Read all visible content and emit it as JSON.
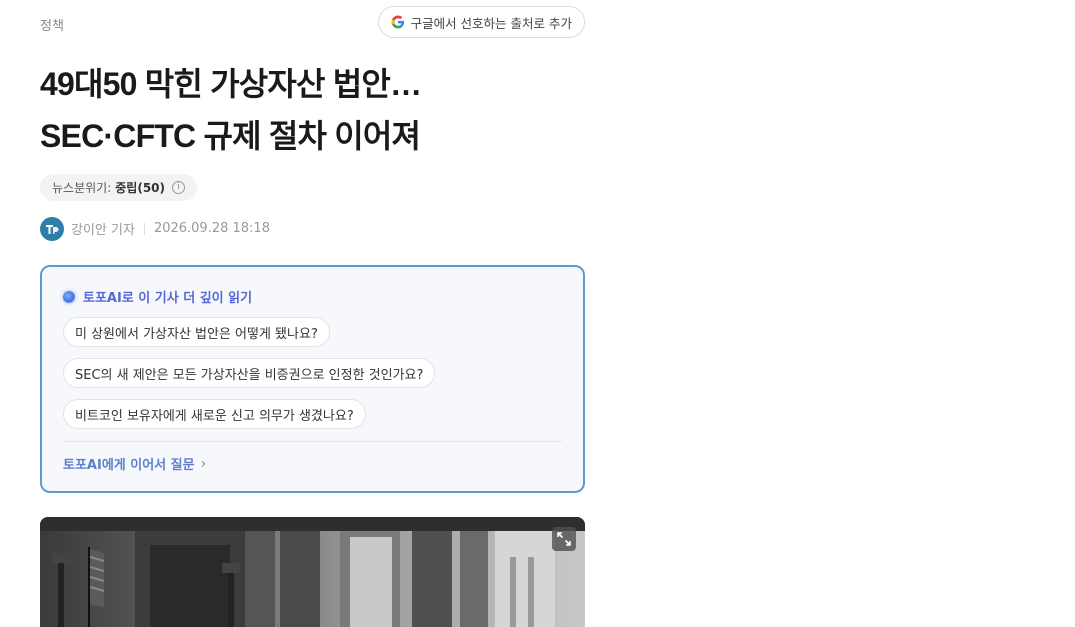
{
  "header": {
    "section": "정책",
    "google_button": "구글에서 선호하는 출처로 추가"
  },
  "article": {
    "title_line1": "49대50 막힌 가상자산 법안…",
    "title_line2": "SEC·CFTC 규제 절차 이어져",
    "sentiment_label": "뉴스분위기:",
    "sentiment_value": "중립(50)",
    "author": "강이안 기자",
    "datetime": "2026.09.28 18:18"
  },
  "ai_panel": {
    "heading": "토포AI로 이 기사 더 깊이 읽기",
    "questions": [
      "미 상원에서 가상자산 법안은 어떻게 됐나요?",
      "SEC의 새 제안은 모든 가상자산을 비증권으로 인정한 것인가요?",
      "비트코인 보유자에게 새로운 신고 의무가 생겼나요?"
    ],
    "follow_up": "토포AI에게 이어서 질문"
  },
  "icons": {
    "google": "google-g-icon",
    "info": "info-icon",
    "sparkle": "sparkle-icon",
    "chevron": "chevron-right-icon",
    "expand": "expand-icon",
    "avatar": "publisher-logo"
  },
  "colors": {
    "accent_blue": "#5b9bd4",
    "ai_text": "#5568d6",
    "avatar_bg": "#2e7fa8"
  }
}
